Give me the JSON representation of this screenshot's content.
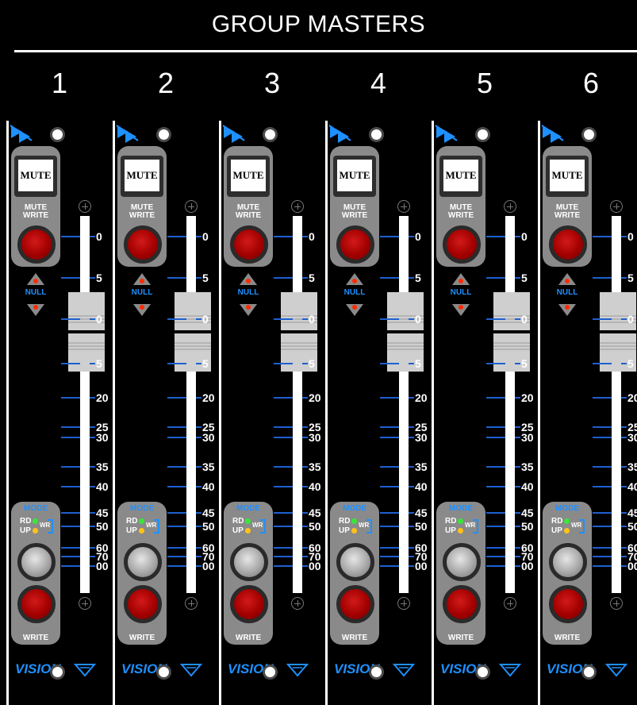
{
  "header": {
    "title": "GROUP MASTERS"
  },
  "channels": [
    {
      "number": "1"
    },
    {
      "number": "2"
    },
    {
      "number": "3"
    },
    {
      "number": "4"
    },
    {
      "number": "5"
    },
    {
      "number": "6"
    }
  ],
  "strip": {
    "mute_label": "MUTE",
    "mute_write_line1": "MUTE",
    "mute_write_line2": "WRITE",
    "null_label": "NULL",
    "mode_label": "MODE",
    "rd_label": "RD",
    "up_label": "UP",
    "wr_label": "WR",
    "write_label": "WRITE",
    "brand": "VISION",
    "scale": [
      "0",
      "5",
      "0",
      "5",
      "20",
      "25",
      "30",
      "35",
      "40",
      "45",
      "50",
      "60",
      "70",
      "00"
    ]
  },
  "colors": {
    "accent_blue": "#1e90ff",
    "scale_blue": "#1e5fd0",
    "button_red": "#a30000",
    "led_green": "#39e639",
    "led_yellow": "#ffc21a",
    "panel_grey": "#8a8a8a"
  }
}
